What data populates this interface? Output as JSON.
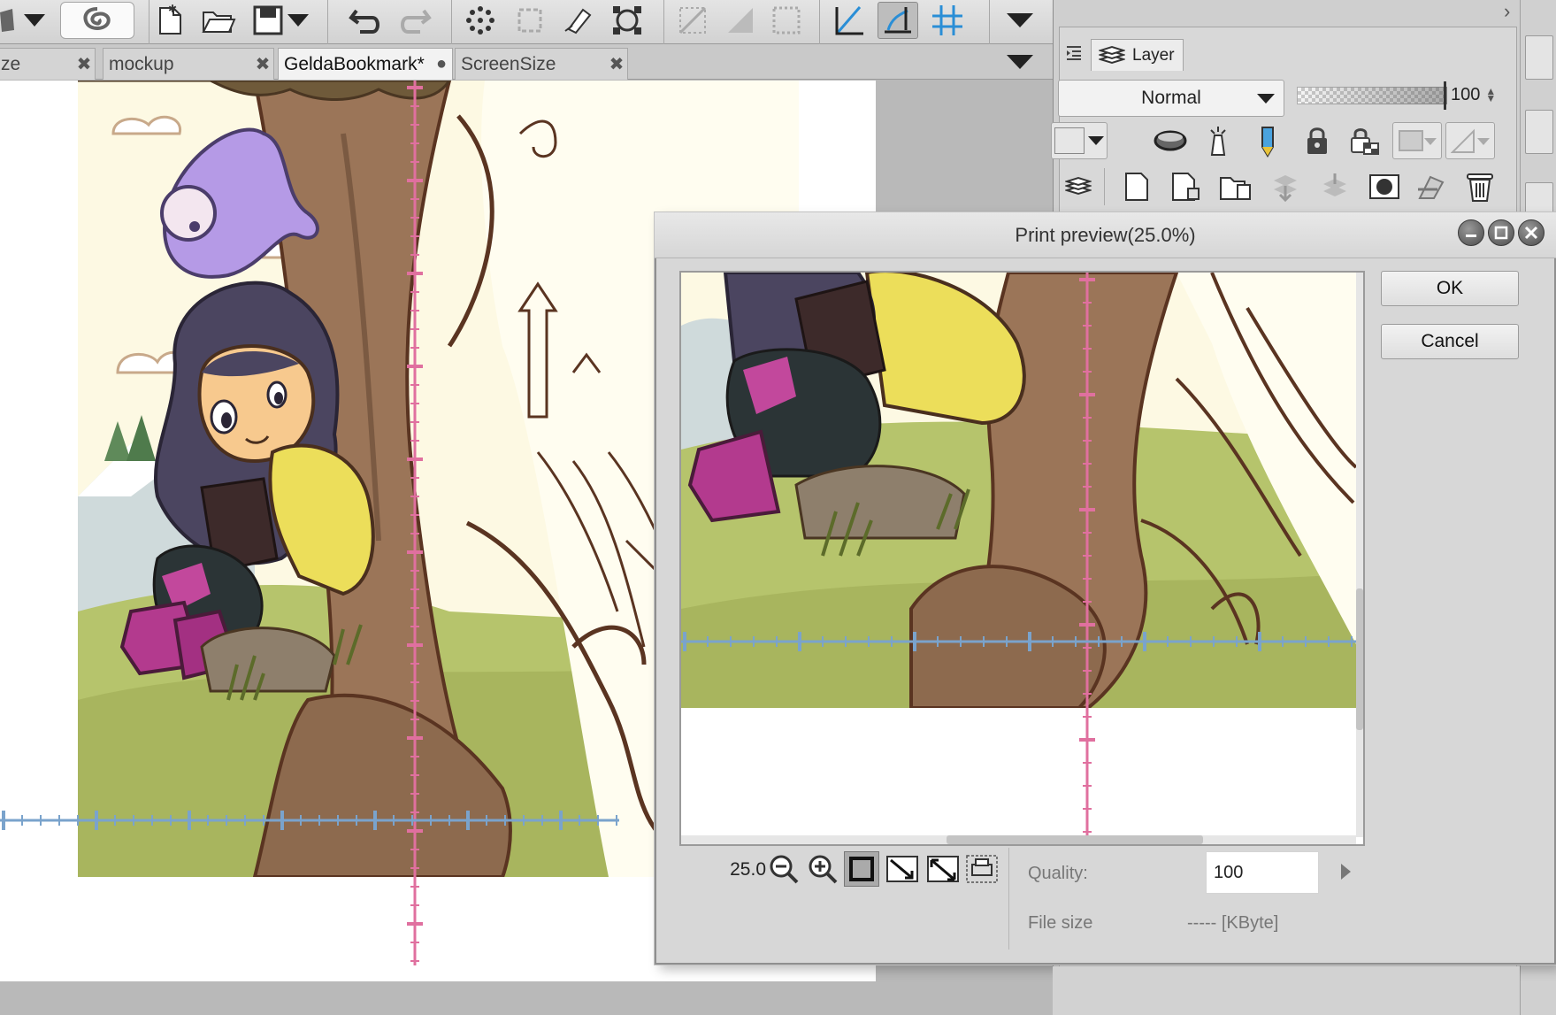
{
  "toolbar": {
    "tools": [
      {
        "icon": "lasso-icon"
      },
      {
        "icon": "new-file-icon"
      },
      {
        "icon": "open-file-icon"
      },
      {
        "icon": "save-icon"
      },
      {
        "icon": "undo-icon"
      },
      {
        "icon": "redo-icon"
      },
      {
        "icon": "fill-dots-icon"
      },
      {
        "icon": "selection-icon"
      },
      {
        "icon": "clear-icon"
      },
      {
        "icon": "transform-icon"
      },
      {
        "icon": "ruler-icon"
      },
      {
        "icon": "perspective-ruler-icon"
      },
      {
        "icon": "snap-grid-icon"
      },
      {
        "icon": "snap-ruler-icon"
      }
    ]
  },
  "tabs": [
    {
      "label": "ze",
      "close": "✖"
    },
    {
      "label": "mockup",
      "close": "✖"
    },
    {
      "label": "GeldaBookmark*",
      "close": "●"
    },
    {
      "label": "ScreenSize",
      "close": "✖"
    }
  ],
  "layer_panel": {
    "tab_label": "Layer",
    "blend_mode": "Normal",
    "opacity": "100",
    "accent_colors": {
      "pencil": "#4aa3df",
      "pencil_tip": "#e8c33a"
    }
  },
  "dialog": {
    "title": "Print preview(25.0%)",
    "ok_label": "OK",
    "cancel_label": "Cancel",
    "zoom_value": "25.0",
    "quality_label": "Quality:",
    "quality_value": "100",
    "file_size_label": "File size",
    "file_size_value": "----- [KByte]"
  },
  "colors": {
    "ruler_vertical": "#e0709f",
    "ruler_horizontal": "#7aa3cc",
    "tree_trunk": "#9b7558",
    "grass": "#b6c46c",
    "sky": "#fdf9e3",
    "hair": "#4b4560",
    "jacket": "#ecde5a",
    "boots": "#b33a8e"
  }
}
